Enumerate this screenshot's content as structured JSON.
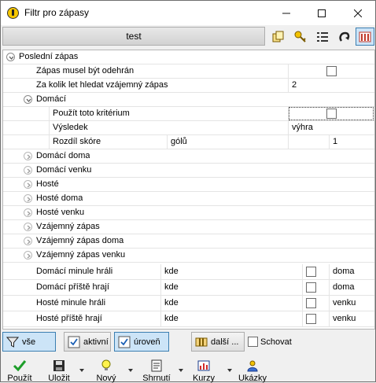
{
  "window": {
    "title": "Filtr pro zápasy"
  },
  "window_controls": {
    "minimize": "—",
    "maximize": "☐",
    "close": "✕"
  },
  "toolbar": {
    "profile_label": "test"
  },
  "tree": {
    "root_label": "Poslední zápas",
    "root_rows": [
      {
        "label": "Zápas musel být odehrán",
        "value": "",
        "checkbox": true
      },
      {
        "label": "Za kolik let hledat vzájemný zápas",
        "value": "2",
        "checkbox": false
      }
    ],
    "domaci": {
      "label": "Domácí",
      "rows": [
        {
          "label": "Použít toto kritérium",
          "value": ""
        },
        {
          "label": "Výsledek",
          "value": "výhra"
        },
        {
          "label": "Rozdíl skóre",
          "mid": "gólů",
          "value": "1"
        }
      ]
    },
    "collapsed_groups": [
      "Domácí doma",
      "Domácí venku",
      "Hosté",
      "Hosté doma",
      "Hosté venku",
      "Vzájemný zápas",
      "Vzájemný zápas doma",
      "Vzájemný zápas venku"
    ],
    "bottom_rows": [
      {
        "label": "Domácí minule hráli",
        "mid": "kde",
        "value": "doma"
      },
      {
        "label": "Domácí příště hrají",
        "mid": "kde",
        "value": "doma"
      },
      {
        "label": "Hosté minule hráli",
        "mid": "kde",
        "value": "venku"
      },
      {
        "label": "Hosté příště hrají",
        "mid": "kde",
        "value": "venku"
      }
    ]
  },
  "filterbar": {
    "all_label": "vše",
    "active_label": "aktivní",
    "level_label": "úroveň",
    "more_label": "další ...",
    "hide_label": "Schovat"
  },
  "bottombar": {
    "apply": "Použít",
    "save": "Uložit",
    "new": "Nový",
    "summary": "Shrnutí",
    "odds": "Kurzy",
    "samples": "Ukázky"
  }
}
